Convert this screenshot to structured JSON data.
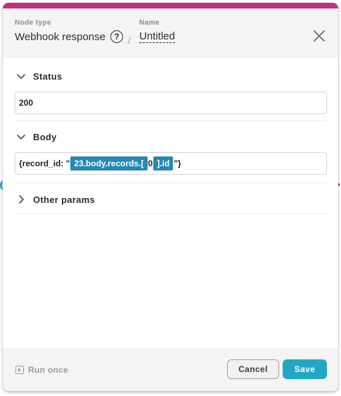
{
  "header": {
    "node_type_label": "Node type",
    "node_type_value": "Webhook response",
    "help_glyph": "?",
    "separator": "/",
    "name_label": "Name",
    "name_value": "Untitled"
  },
  "sections": {
    "status": {
      "title": "Status",
      "value": "200",
      "expanded": true
    },
    "body": {
      "title": "Body",
      "expanded": true,
      "segments": [
        "{record_id: \"",
        "23.body.records.[",
        "0",
        "].id",
        "\"}"
      ]
    },
    "other": {
      "title": "Other params",
      "expanded": false
    }
  },
  "footer": {
    "run_once_label": "Run once",
    "cancel_label": "Cancel",
    "save_label": "Save"
  },
  "colors": {
    "accent_bar": "#c2307b",
    "primary": "#26a6c5",
    "token": "#2689b3"
  },
  "icons": [
    "help-icon",
    "close-icon",
    "chevron-down-icon",
    "chevron-right-icon",
    "run-icon"
  ]
}
